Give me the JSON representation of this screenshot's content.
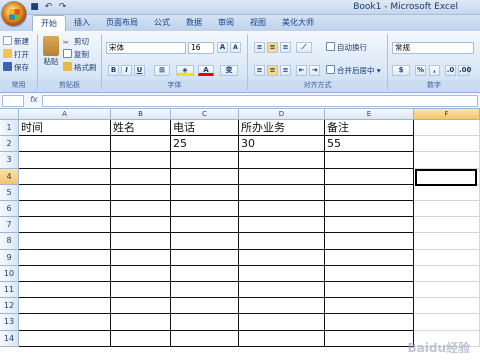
{
  "app": {
    "title": "Book1 - Microsoft Excel"
  },
  "quick_access": [
    "save-icon",
    "undo-icon",
    "redo-icon"
  ],
  "tabs": [
    "开始",
    "插入",
    "页面布局",
    "公式",
    "数据",
    "审阅",
    "视图",
    "美化大师"
  ],
  "ribbon": {
    "clipboard": {
      "label": "剪贴板",
      "new": "新建",
      "open": "打开",
      "save": "保存",
      "paste": "粘贴",
      "cut": "剪切",
      "copy": "复制",
      "format_painter": "格式刷"
    },
    "common_label": "常用",
    "font": {
      "label": "字体",
      "name": "宋体",
      "size": "16",
      "grow": "A",
      "shrink": "A",
      "bold": "B",
      "italic": "I",
      "underline": "U",
      "font_color": "A",
      "phonetic": "变"
    },
    "alignment": {
      "label": "对齐方式",
      "wrap": "自动换行",
      "merge": "合并后居中"
    },
    "number": {
      "label": "数字",
      "format": "常规",
      "currency": "%",
      "comma": ","
    }
  },
  "formula_bar": {
    "fx": "fx",
    "content": ""
  },
  "columns": [
    "A",
    "B",
    "C",
    "D",
    "E",
    "F"
  ],
  "rows": [
    "1",
    "2",
    "3",
    "4",
    "5",
    "6",
    "7",
    "8",
    "9",
    "10",
    "11",
    "12",
    "13",
    "14"
  ],
  "cells": {
    "A1": "时间",
    "B1": "姓名",
    "C1": "电话",
    "D1": "所办业务",
    "E1": "备注",
    "C2": "25",
    "D2": "30",
    "E2": "55"
  },
  "selected_cell": "F4",
  "watermark": "Baidu经验"
}
